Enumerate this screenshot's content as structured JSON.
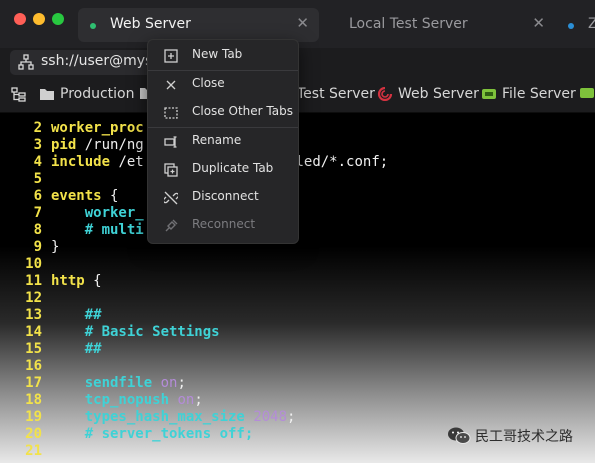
{
  "window": {
    "traffic_lights": {
      "close": "#ff5f57",
      "minimize": "#febc2e",
      "zoom": "#28c840"
    }
  },
  "tabs": [
    {
      "title": "Web Server",
      "dot_color": "#2fbf71",
      "active": true
    },
    {
      "title": "Local Test Server",
      "dot_color": "#2fbf71",
      "active": false
    },
    {
      "title": "Z",
      "dot_color": "#2b8fd6",
      "active": false
    }
  ],
  "address": {
    "value": "ssh://user@myserv"
  },
  "bookmarks": [
    {
      "label": "Production",
      "icon": "folder-icon"
    },
    {
      "label": "Test Server",
      "icon": "folder-icon"
    },
    {
      "label": "Web Server",
      "icon": "debian-icon"
    },
    {
      "label": "File Server",
      "icon": "server-icon"
    }
  ],
  "context_menu": {
    "items": [
      {
        "label": "New Tab",
        "icon": "new-tab-icon",
        "enabled": true
      },
      {
        "label": "Close",
        "icon": "close-icon",
        "enabled": true
      },
      {
        "label": "Close Other Tabs",
        "icon": "close-others-icon",
        "enabled": true
      },
      {
        "label": "Rename",
        "icon": "rename-icon",
        "enabled": true
      },
      {
        "label": "Duplicate Tab",
        "icon": "duplicate-icon",
        "enabled": true
      },
      {
        "label": "Disconnect",
        "icon": "disconnect-icon",
        "enabled": true
      },
      {
        "label": "Reconnect",
        "icon": "reconnect-icon",
        "enabled": false
      }
    ]
  },
  "terminal": {
    "lines": [
      {
        "n": "2",
        "seg": [
          {
            "c": "kw",
            "t": "worker_proc"
          }
        ]
      },
      {
        "n": "3",
        "seg": [
          {
            "c": "kw",
            "t": "pid"
          },
          {
            "c": "txt",
            "t": " /run/ng"
          }
        ]
      },
      {
        "n": "4",
        "seg": [
          {
            "c": "kw",
            "t": "include"
          },
          {
            "c": "txt",
            "t": " /et"
          },
          {
            "c": "gap",
            "t": "              "
          },
          {
            "c": "txt",
            "t": "enabled/*.conf;"
          }
        ]
      },
      {
        "n": "5",
        "seg": []
      },
      {
        "n": "6",
        "seg": [
          {
            "c": "kw",
            "t": "events"
          },
          {
            "c": "txt",
            "t": " {"
          }
        ]
      },
      {
        "n": "7",
        "seg": [
          {
            "c": "txt",
            "t": "    "
          },
          {
            "c": "dir",
            "t": "worker_"
          }
        ]
      },
      {
        "n": "8",
        "seg": [
          {
            "c": "txt",
            "t": "    "
          },
          {
            "c": "cm",
            "t": "# multi"
          }
        ]
      },
      {
        "n": "9",
        "seg": [
          {
            "c": "txt",
            "t": "}"
          }
        ]
      },
      {
        "n": "10",
        "seg": []
      },
      {
        "n": "11",
        "seg": [
          {
            "c": "kw",
            "t": "http"
          },
          {
            "c": "txt",
            "t": " {"
          }
        ]
      },
      {
        "n": "12",
        "seg": []
      },
      {
        "n": "13",
        "seg": [
          {
            "c": "txt",
            "t": "    "
          },
          {
            "c": "cm",
            "t": "##"
          }
        ]
      },
      {
        "n": "14",
        "seg": [
          {
            "c": "txt",
            "t": "    "
          },
          {
            "c": "cm",
            "t": "# Basic Settings"
          }
        ]
      },
      {
        "n": "15",
        "seg": [
          {
            "c": "txt",
            "t": "    "
          },
          {
            "c": "cm",
            "t": "##"
          }
        ]
      },
      {
        "n": "16",
        "seg": []
      },
      {
        "n": "17",
        "seg": [
          {
            "c": "txt",
            "t": "    "
          },
          {
            "c": "dir",
            "t": "sendfile"
          },
          {
            "c": "txt",
            "t": " "
          },
          {
            "c": "val",
            "t": "on"
          },
          {
            "c": "txt",
            "t": ";"
          }
        ]
      },
      {
        "n": "18",
        "seg": [
          {
            "c": "txt",
            "t": "    "
          },
          {
            "c": "dir",
            "t": "tcp_nopush"
          },
          {
            "c": "txt",
            "t": " "
          },
          {
            "c": "val",
            "t": "on"
          },
          {
            "c": "txt",
            "t": ";"
          }
        ]
      },
      {
        "n": "19",
        "seg": [
          {
            "c": "txt",
            "t": "    "
          },
          {
            "c": "dir",
            "t": "types_hash_max_size"
          },
          {
            "c": "txt",
            "t": " "
          },
          {
            "c": "val",
            "t": "2048"
          },
          {
            "c": "txt",
            "t": ";"
          }
        ]
      },
      {
        "n": "20",
        "seg": [
          {
            "c": "txt",
            "t": "    "
          },
          {
            "c": "cm",
            "t": "# server_tokens off;"
          }
        ]
      },
      {
        "n": "21",
        "seg": []
      }
    ]
  },
  "watermark": {
    "text": "民工哥技术之路"
  }
}
